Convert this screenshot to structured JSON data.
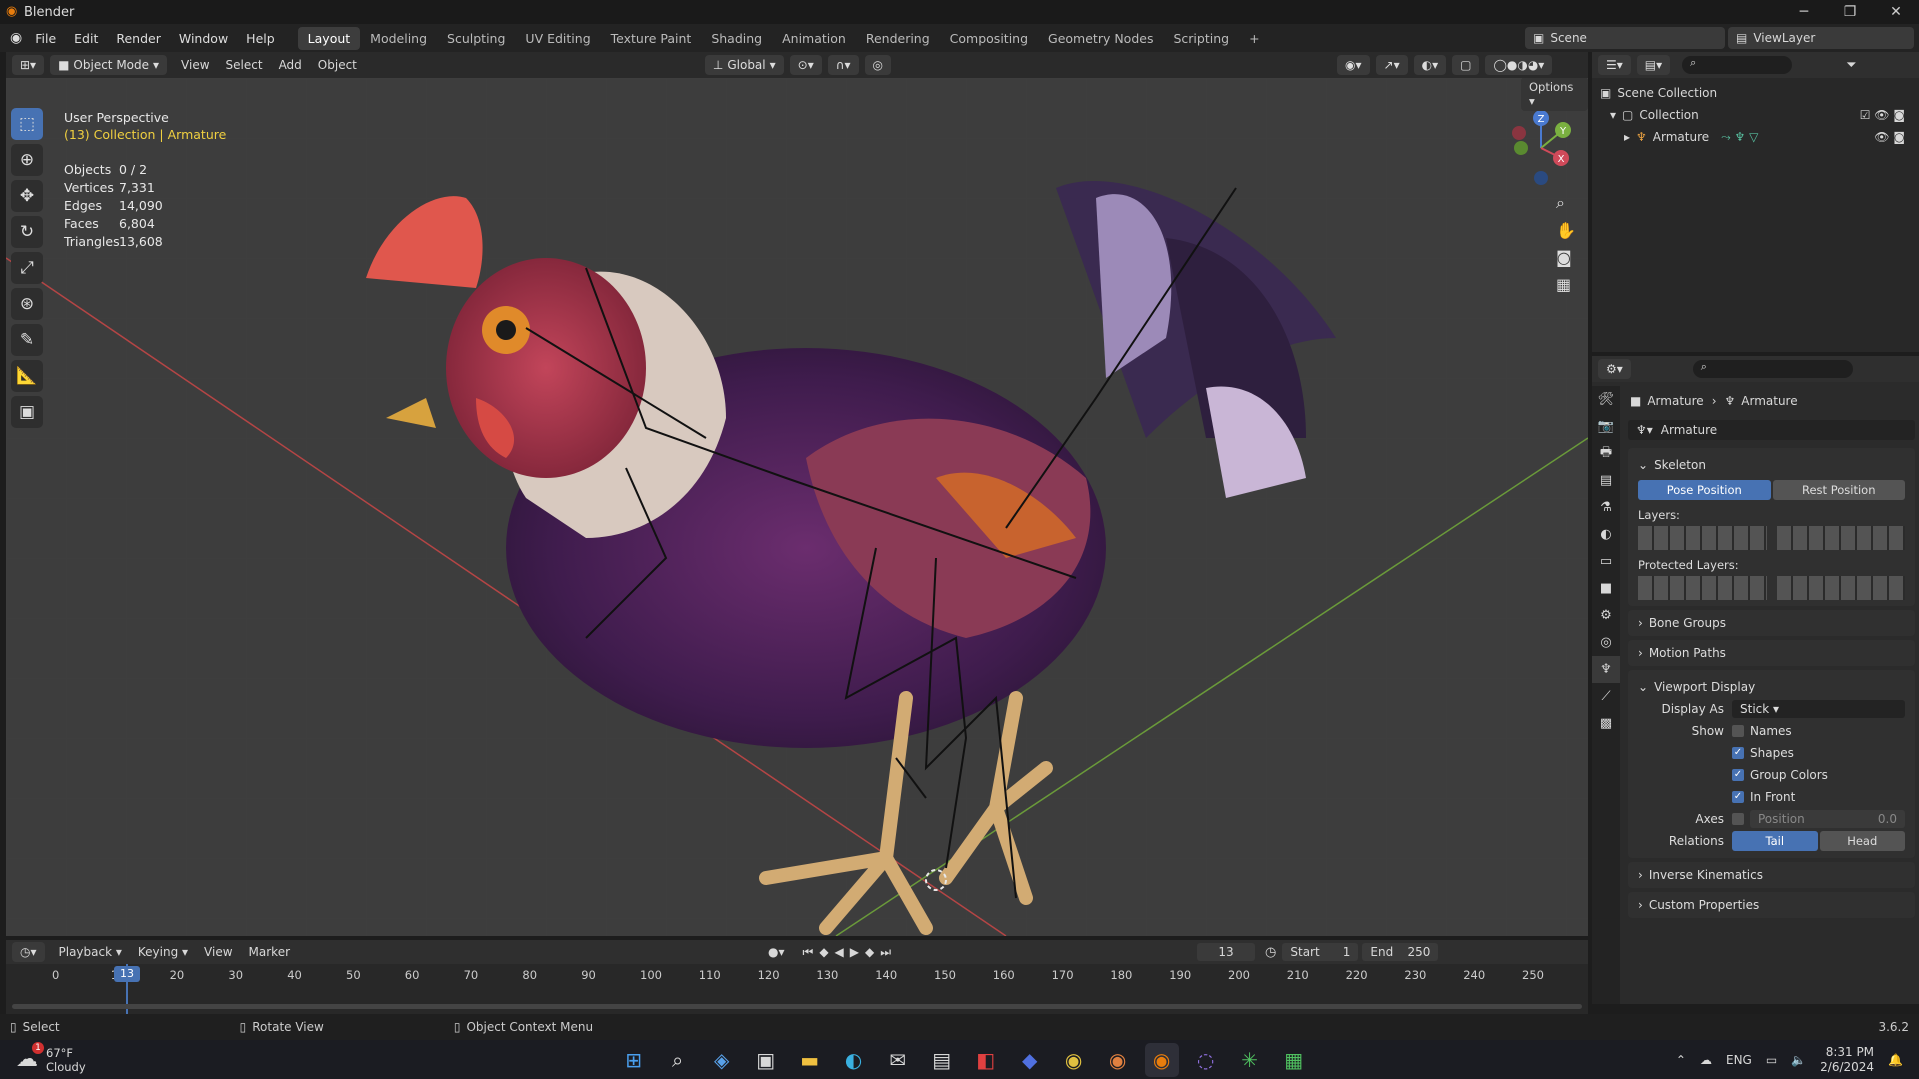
{
  "window": {
    "title": "Blender"
  },
  "menu": {
    "items": [
      "File",
      "Edit",
      "Render",
      "Window",
      "Help"
    ]
  },
  "workspaces": [
    "Layout",
    "Modeling",
    "Sculpting",
    "UV Editing",
    "Texture Paint",
    "Shading",
    "Animation",
    "Rendering",
    "Compositing",
    "Geometry Nodes",
    "Scripting"
  ],
  "active_workspace": "Layout",
  "scene": {
    "label": "Scene",
    "view_layer": "ViewLayer"
  },
  "viewport_header": {
    "mode": "Object Mode",
    "menus": [
      "View",
      "Select",
      "Add",
      "Object"
    ],
    "orientation": "Global",
    "options": "Options"
  },
  "viewport": {
    "perspective": "User Perspective",
    "collection_info": "(13) Collection | Armature",
    "stats": [
      {
        "label": "Objects",
        "value": "0 / 2"
      },
      {
        "label": "Vertices",
        "value": "7,331"
      },
      {
        "label": "Edges",
        "value": "14,090"
      },
      {
        "label": "Faces",
        "value": "6,804"
      },
      {
        "label": "Triangles",
        "value": "13,608"
      }
    ],
    "gizmo": {
      "z": "Z",
      "y": "Y",
      "x": "X"
    }
  },
  "outliner": {
    "root": "Scene Collection",
    "collection": "Collection",
    "object": "Armature"
  },
  "properties": {
    "breadcrumb": [
      "Armature",
      "Armature"
    ],
    "datablock": "Armature",
    "skeleton": {
      "title": "Skeleton",
      "pose": "Pose Position",
      "rest": "Rest Position",
      "layers": "Layers:",
      "protected": "Protected Layers:"
    },
    "panels": [
      "Bone Groups",
      "Motion Paths"
    ],
    "viewport_display": {
      "title": "Viewport Display",
      "display_as_label": "Display As",
      "display_as": "Stick",
      "show_label": "Show",
      "show": [
        {
          "label": "Names",
          "checked": false
        },
        {
          "label": "Shapes",
          "checked": true
        },
        {
          "label": "Group Colors",
          "checked": true
        },
        {
          "label": "In Front",
          "checked": true
        }
      ],
      "axes_label": "Axes",
      "position_label": "Position",
      "position_value": "0.0",
      "relations_label": "Relations",
      "tail": "Tail",
      "head": "Head"
    },
    "bottom_panels": [
      "Inverse Kinematics",
      "Custom Properties"
    ]
  },
  "timeline": {
    "menus": [
      "Playback",
      "Keying",
      "View",
      "Marker"
    ],
    "current_frame": "13",
    "start_label": "Start",
    "start": "1",
    "end_label": "End",
    "end": "250",
    "ticks": [
      "0",
      "10",
      "20",
      "30",
      "40",
      "50",
      "60",
      "70",
      "80",
      "90",
      "100",
      "110",
      "120",
      "130",
      "140",
      "150",
      "160",
      "170",
      "180",
      "190",
      "200",
      "210",
      "220",
      "230",
      "240",
      "250"
    ],
    "playhead_label": "13"
  },
  "statusbar": {
    "select": "Select",
    "rotate": "Rotate View",
    "context": "Object Context Menu",
    "version": "3.6.2"
  },
  "taskbar": {
    "weather_temp": "67°F",
    "weather_desc": "Cloudy",
    "weather_badge": "1",
    "lang": "ENG",
    "time": "8:31 PM",
    "date": "2/6/2024"
  }
}
